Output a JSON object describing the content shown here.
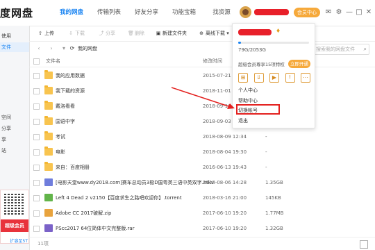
{
  "app": {
    "brand": "度网盘"
  },
  "top_tabs": [
    {
      "label": "我的网盘",
      "active": true
    },
    {
      "label": "传输列表",
      "active": false
    },
    {
      "label": "好友分享",
      "active": false
    },
    {
      "label": "功能宝箱",
      "active": false
    },
    {
      "label": "找资源",
      "active": false
    }
  ],
  "header": {
    "member_label": "会员中心",
    "icons": [
      "message-icon",
      "settings-icon",
      "minimize-icon",
      "maximize-icon",
      "close-icon"
    ]
  },
  "sidebar": {
    "items": [
      {
        "label": "使用",
        "active": false
      },
      {
        "label": "文件",
        "active": true
      },
      {
        "label": "",
        "active": false
      },
      {
        "label": "",
        "active": false
      },
      {
        "label": "",
        "active": false
      },
      {
        "label": "",
        "active": false
      },
      {
        "label": "空间",
        "active": false
      },
      {
        "label": "分享",
        "active": false
      },
      {
        "label": "享",
        "active": false
      },
      {
        "label": "站",
        "active": false
      }
    ],
    "promo_text": "超级会员",
    "expand_label": "扩容至5T"
  },
  "toolbar": {
    "upload": "上传",
    "download": "下载",
    "share": "分享",
    "delete": "删除",
    "new_folder": "新建文件夹",
    "offline": "离线下载"
  },
  "pathbar": {
    "crumb": "我的网盘",
    "search_placeholder": "搜索我的网盘文件"
  },
  "columns": {
    "name": "文件名",
    "date": "修改时间",
    "size": "大小"
  },
  "files": [
    {
      "name": "我的应用数据",
      "date": "2015-07-21 15:21",
      "size": "-",
      "type": "folder"
    },
    {
      "name": "我下载的资源",
      "date": "2018-11-01 09:15",
      "size": "-",
      "type": "folder"
    },
    {
      "name": "戴洛看看",
      "date": "2018-09-16 21:02",
      "size": "-",
      "type": "folder"
    },
    {
      "name": "国语中字",
      "date": "2018-09-03 20:45",
      "size": "-",
      "type": "folder"
    },
    {
      "name": "考试",
      "date": "2018-08-09 12:34",
      "size": "-",
      "type": "folder"
    },
    {
      "name": "电影",
      "date": "2018-08-04 19:30",
      "size": "-",
      "type": "folder"
    },
    {
      "name": "来自：百度相册",
      "date": "2016-06-13 19:43",
      "size": "-",
      "type": "folder"
    },
    {
      "name": "[电影天堂www.dy2018.com]赛车总动员3极D国粤英三语中英双字.mkv",
      "date": "2018-08-06 14:28",
      "size": "1.35GB",
      "type": "video"
    },
    {
      "name": "Left 4 Dead 2 v2150【百度求生之路吧欢迎你】.torrent",
      "date": "2018-03-16 21:00",
      "size": "145KB",
      "type": "torrent"
    },
    {
      "name": "Adobe CC 2017破解.zip",
      "date": "2017-06-10 19:20",
      "size": "1.77MB",
      "type": "zip"
    },
    {
      "name": "PScc2017 64位简体中文完整版.rar",
      "date": "2017-06-10 19:20",
      "size": "1.32GB",
      "type": "rar"
    }
  ],
  "status": {
    "count": "11项"
  },
  "menu": {
    "quota": "79G/2053G",
    "quota_fraction": 0.038,
    "vip_text": "超级会员尊享15项特权",
    "vip_btn": "立即开通",
    "items": [
      "个人中心",
      "帮助中心",
      "切换帐号",
      "退出"
    ],
    "highlighted_item": "切换帐号"
  },
  "colors": {
    "accent": "#1883f2",
    "highlight": "#e3201e",
    "member": "#f6a93b",
    "folder": "#f8c44f"
  }
}
